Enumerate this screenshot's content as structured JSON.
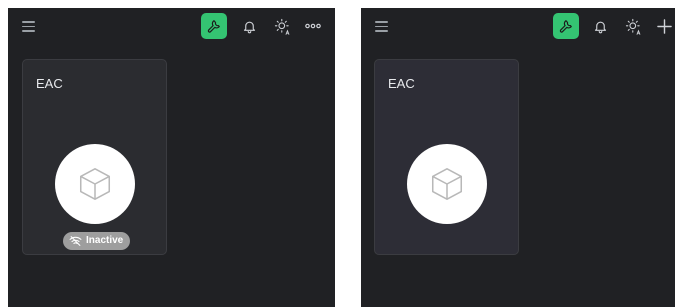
{
  "colors": {
    "page_background": "#ffffff",
    "panel_background": "#202124",
    "card_background_left": "#2b2c30",
    "card_background_right": "#2d2d36",
    "accent_green": "#34c472",
    "badge_gray": "#9e9e9e",
    "icon_gray": "#9aa0a6"
  },
  "left_screen": {
    "topbar": {
      "icons": [
        "menu-icon",
        "wrench-icon",
        "bell-icon",
        "brightness-auto-icon",
        "more-icon"
      ]
    },
    "device_card": {
      "title": "EAC",
      "icon": "cube-icon",
      "status": {
        "label": "Inactive",
        "icon": "wifi-off-icon"
      }
    }
  },
  "right_screen": {
    "topbar": {
      "icons": [
        "menu-icon",
        "wrench-icon",
        "bell-icon",
        "brightness-auto-icon",
        "plus-icon"
      ]
    },
    "device_card": {
      "title": "EAC",
      "icon": "cube-icon"
    }
  }
}
